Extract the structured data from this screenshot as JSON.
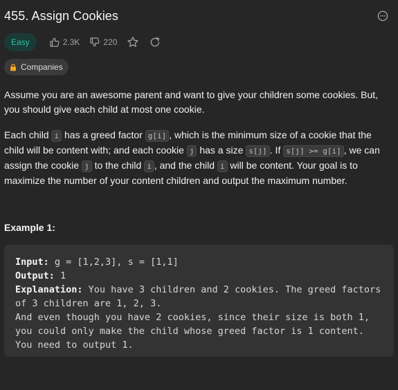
{
  "problem": {
    "title": "455. Assign Cookies",
    "difficulty": "Easy",
    "likes": "2.3K",
    "dislikes": "220",
    "companies_label": "Companies"
  },
  "description": {
    "p1": "Assume you are an awesome parent and want to give your children some cookies. But, you should give each child at most one cookie.",
    "p2": {
      "t1": "Each child ",
      "c1": "i",
      "t2": " has a greed factor ",
      "c2": "g[i]",
      "t3": ", which is the minimum size of a cookie that the child will be content with; and each cookie ",
      "c3": "j",
      "t4": " has a size ",
      "c4": "s[j]",
      "t5": ". If ",
      "c5": "s[j] >= g[i]",
      "t6": ", we can assign the cookie ",
      "c6": "j",
      "t7": " to the child ",
      "c7": "i",
      "t8": ", and the child ",
      "c8": "i",
      "t9": " will be content. Your goal is to maximize the number of your content children and output the maximum number."
    }
  },
  "example1": {
    "heading": "Example 1:",
    "input_label": "Input:",
    "input_value": " g = [1,2,3], s = [1,1]",
    "output_label": "Output:",
    "output_value": " 1",
    "explanation_label": "Explanation:",
    "explanation_value": " You have 3 children and 2 cookies. The greed factors of 3 children are 1, 2, 3.",
    "line2": "And even though you have 2 cookies, since their size is both 1, you could only make the child whose greed factor is 1 content.",
    "line3": "You need to output 1."
  },
  "colors": {
    "background": "#262626",
    "easy_text": "#2ac3a2",
    "easy_bg": "#1a3a36",
    "lock": "#f5a623"
  },
  "icons": [
    "more-icon",
    "thumbs-up-icon",
    "thumbs-down-icon",
    "star-icon",
    "share-icon",
    "lock-icon"
  ]
}
